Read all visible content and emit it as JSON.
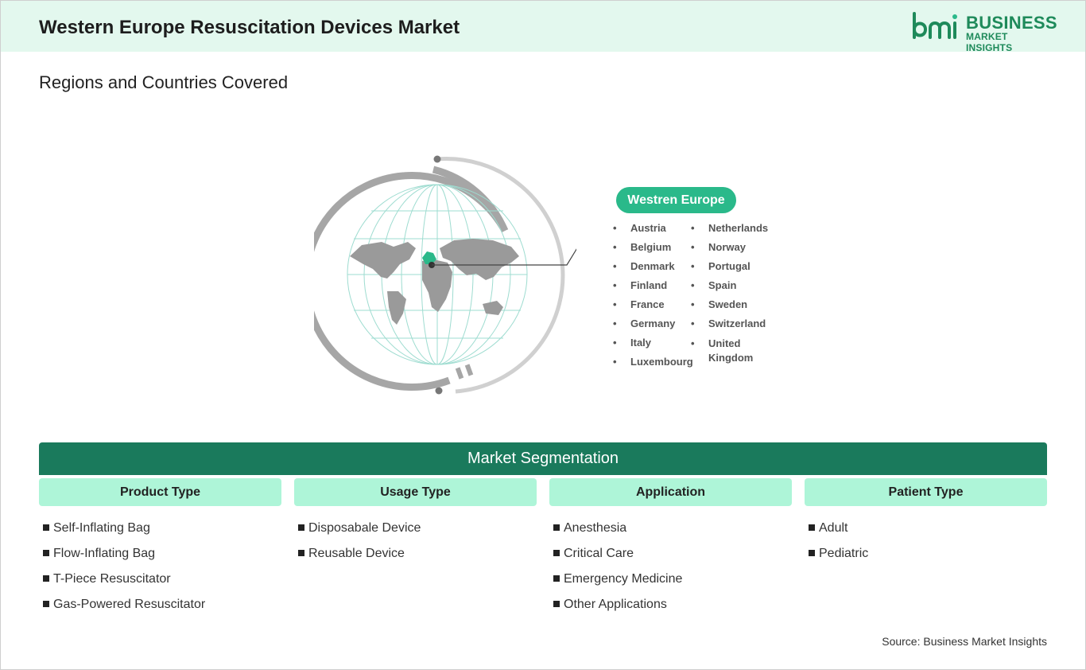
{
  "header": {
    "title": "Western Europe Resuscitation Devices Market"
  },
  "logo": {
    "line1": "BUSINESS",
    "line2": "MARKET INSIGHTS"
  },
  "section_title": "Regions and Countries Covered",
  "region": {
    "name": "Westren Europe",
    "countries_col1": [
      "Austria",
      "Belgium",
      "Denmark",
      "Finland",
      "France",
      "Germany",
      "Italy",
      "Luxembourg"
    ],
    "countries_col2": [
      "Netherlands",
      "Norway",
      "Portugal",
      "Spain",
      "Sweden",
      "Switzerland",
      "United Kingdom"
    ]
  },
  "segmentation": {
    "title": "Market Segmentation",
    "columns": [
      {
        "header": "Product Type",
        "items": [
          "Self-Inflating Bag",
          "Flow-Inflating Bag",
          "T-Piece Resuscitator",
          "Gas-Powered Resuscitator"
        ]
      },
      {
        "header": "Usage Type",
        "items": [
          "Disposabale Device",
          "Reusable Device"
        ]
      },
      {
        "header": "Application",
        "items": [
          "Anesthesia",
          "Critical Care",
          "Emergency Medicine",
          "Other Applications"
        ]
      },
      {
        "header": "Patient Type",
        "items": [
          "Adult",
          "Pediatric"
        ]
      }
    ]
  },
  "source": "Source: Business Market Insights",
  "colors": {
    "header_bg": "#e3f8ee",
    "accent": "#2ab98a",
    "dark_green": "#1a7a5c",
    "light_green": "#aef5d8",
    "logo_green": "#1e8a5a"
  }
}
